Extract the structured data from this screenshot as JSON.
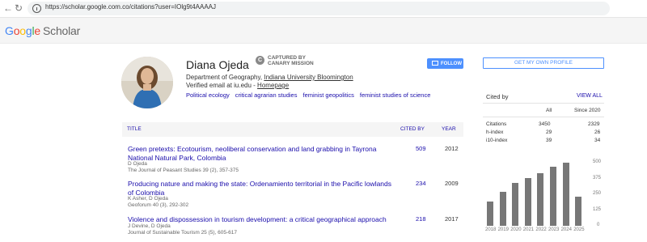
{
  "browser": {
    "url": "https://scholar.google.com.co/citations?user=IOlg9t4AAAAJ"
  },
  "brand": {
    "logo_google": [
      "G",
      "o",
      "o",
      "g",
      "l",
      "e"
    ],
    "logo_scholar": "Scholar"
  },
  "profile": {
    "name": "Diana Ojeda",
    "captured_line1": "CAPTURED BY",
    "captured_line2": "CANARY MISSION",
    "affil_prefix": "Department of Geography, ",
    "affil_link": "Indiana University Bloomington",
    "email_prefix": "Verified email at iu.edu - ",
    "homepage": "Homepage",
    "interests": [
      "Political ecology",
      "critical agrarian studies",
      "feminist geopolitics",
      "feminist studies of science"
    ],
    "follow_label": "FOLLOW"
  },
  "my_profile_label": "GET MY OWN PROFILE",
  "table": {
    "col_title": "TITLE",
    "col_cited": "CITED BY",
    "col_year": "YEAR",
    "rows": [
      {
        "title": "Green pretexts: Ecotourism, neoliberal conservation and land grabbing in Tayrona National Natural Park, Colombia",
        "authors": "D Ojeda",
        "pub": "The Journal of Peasant Studies 39 (2), 357-375",
        "cited": "509",
        "year": "2012"
      },
      {
        "title": "Producing nature and making the state: Ordenamiento territorial in the Pacific lowlands of Colombia",
        "authors": "K Asher, D Ojeda",
        "pub": "Geoforum 40 (3), 292-302",
        "cited": "234",
        "year": "2009"
      },
      {
        "title": "Violence and dispossession in tourism development: a critical geographical approach",
        "authors": "J Devine, D Ojeda",
        "pub": "Journal of Sustainable Tourism 25 (5), 605-617",
        "cited": "218",
        "year": "2017"
      }
    ]
  },
  "cited_panel": {
    "title": "Cited by",
    "view_all": "VIEW ALL",
    "col_all": "All",
    "col_since": "Since 2020",
    "stats": [
      {
        "label": "Citations",
        "all": "3450",
        "since": "2329"
      },
      {
        "label": "h-index",
        "all": "29",
        "since": "26"
      },
      {
        "label": "i10-index",
        "all": "39",
        "since": "34"
      }
    ]
  },
  "chart_data": {
    "type": "bar",
    "categories": [
      "2018",
      "2019",
      "2020",
      "2021",
      "2022",
      "2023",
      "2024",
      "2025"
    ],
    "values": [
      190,
      270,
      340,
      380,
      415,
      465,
      500,
      230
    ],
    "ylim": [
      0,
      500
    ],
    "yticks": [
      "500",
      "375",
      "250",
      "125",
      "0"
    ]
  }
}
